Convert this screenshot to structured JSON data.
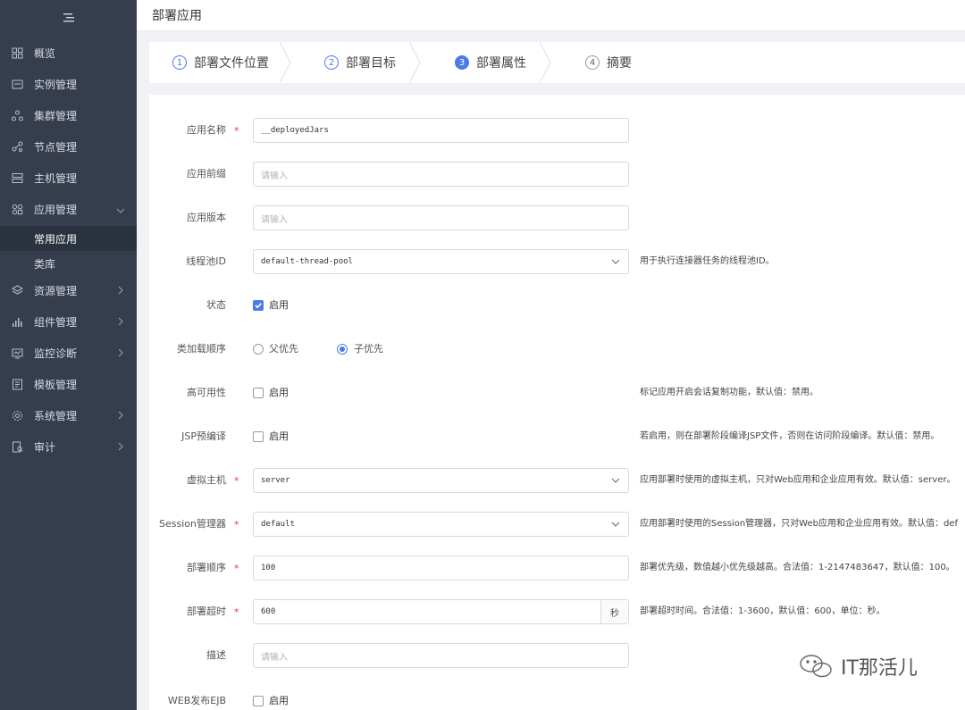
{
  "sidebar": {
    "items": [
      {
        "label": "概览",
        "icon": "overview-icon"
      },
      {
        "label": "实例管理",
        "icon": "instance-icon"
      },
      {
        "label": "集群管理",
        "icon": "cluster-icon"
      },
      {
        "label": "节点管理",
        "icon": "node-icon"
      },
      {
        "label": "主机管理",
        "icon": "host-icon"
      },
      {
        "label": "应用管理",
        "icon": "app-icon",
        "arrow": "expanded"
      },
      {
        "label": "资源管理",
        "icon": "resource-icon",
        "arrow": "collapsed"
      },
      {
        "label": "组件管理",
        "icon": "component-icon",
        "arrow": "collapsed"
      },
      {
        "label": "监控诊断",
        "icon": "monitor-icon",
        "arrow": "collapsed"
      },
      {
        "label": "模板管理",
        "icon": "template-icon"
      },
      {
        "label": "系统管理",
        "icon": "settings-icon",
        "arrow": "collapsed"
      },
      {
        "label": "审计",
        "icon": "audit-icon",
        "arrow": "collapsed"
      }
    ],
    "submenu": [
      {
        "label": "常用应用",
        "active": true
      },
      {
        "label": "类库",
        "active": false
      }
    ]
  },
  "header": {
    "title": "部署应用"
  },
  "steps": [
    {
      "num": "1",
      "label": "部署文件位置",
      "state": "done"
    },
    {
      "num": "2",
      "label": "部署目标",
      "state": "done"
    },
    {
      "num": "3",
      "label": "部署属性",
      "state": "active"
    },
    {
      "num": "4",
      "label": "摘要",
      "state": "pending"
    }
  ],
  "form": {
    "app_name": {
      "label": "应用名称",
      "value": "__deployedJars"
    },
    "app_prefix": {
      "label": "应用前缀",
      "placeholder": "请输入"
    },
    "app_version": {
      "label": "应用版本",
      "placeholder": "请输入"
    },
    "thread_pool": {
      "label": "线程池ID",
      "value": "default-thread-pool",
      "help": "用于执行连接器任务的线程池ID。"
    },
    "status": {
      "label": "状态",
      "option": "启用",
      "checked": true
    },
    "class_loading": {
      "label": "类加载顺序",
      "options": [
        "父优先",
        "子优先"
      ],
      "selected": "子优先"
    },
    "ha": {
      "label": "高可用性",
      "option": "启用",
      "checked": false,
      "help": "标记应用开启会话复制功能，默认值：禁用。"
    },
    "jsp": {
      "label": "JSP预编译",
      "option": "启用",
      "checked": false,
      "help": "若启用，则在部署阶段编译JSP文件，否则在访问阶段编译。默认值：禁用。"
    },
    "vhost": {
      "label": "虚拟主机",
      "value": "server",
      "help": "应用部署时使用的虚拟主机，只对Web应用和企业应用有效。默认值：server。"
    },
    "session": {
      "label": "Session管理器",
      "value": "default",
      "help": "应用部署时使用的Session管理器，只对Web应用和企业应用有效。默认值：def"
    },
    "order": {
      "label": "部署顺序",
      "value": "100",
      "help": "部署优先级，数值越小优先级越高。合法值：1-2147483647，默认值：100。"
    },
    "timeout": {
      "label": "部署超时",
      "value": "600",
      "suffix": "秒",
      "help": "部署超时时间。合法值：1-3600，默认值：600，单位：秒。"
    },
    "desc": {
      "label": "描述",
      "placeholder": "请输入"
    },
    "web_ejb": {
      "label": "WEB发布EJB",
      "option": "启用",
      "checked": false
    }
  },
  "required_mark": "*",
  "watermark": {
    "text": "IT那活儿"
  },
  "colors": {
    "sidebar_bg": "#363e4e",
    "accent": "#4b7be5",
    "required": "#e53935"
  }
}
